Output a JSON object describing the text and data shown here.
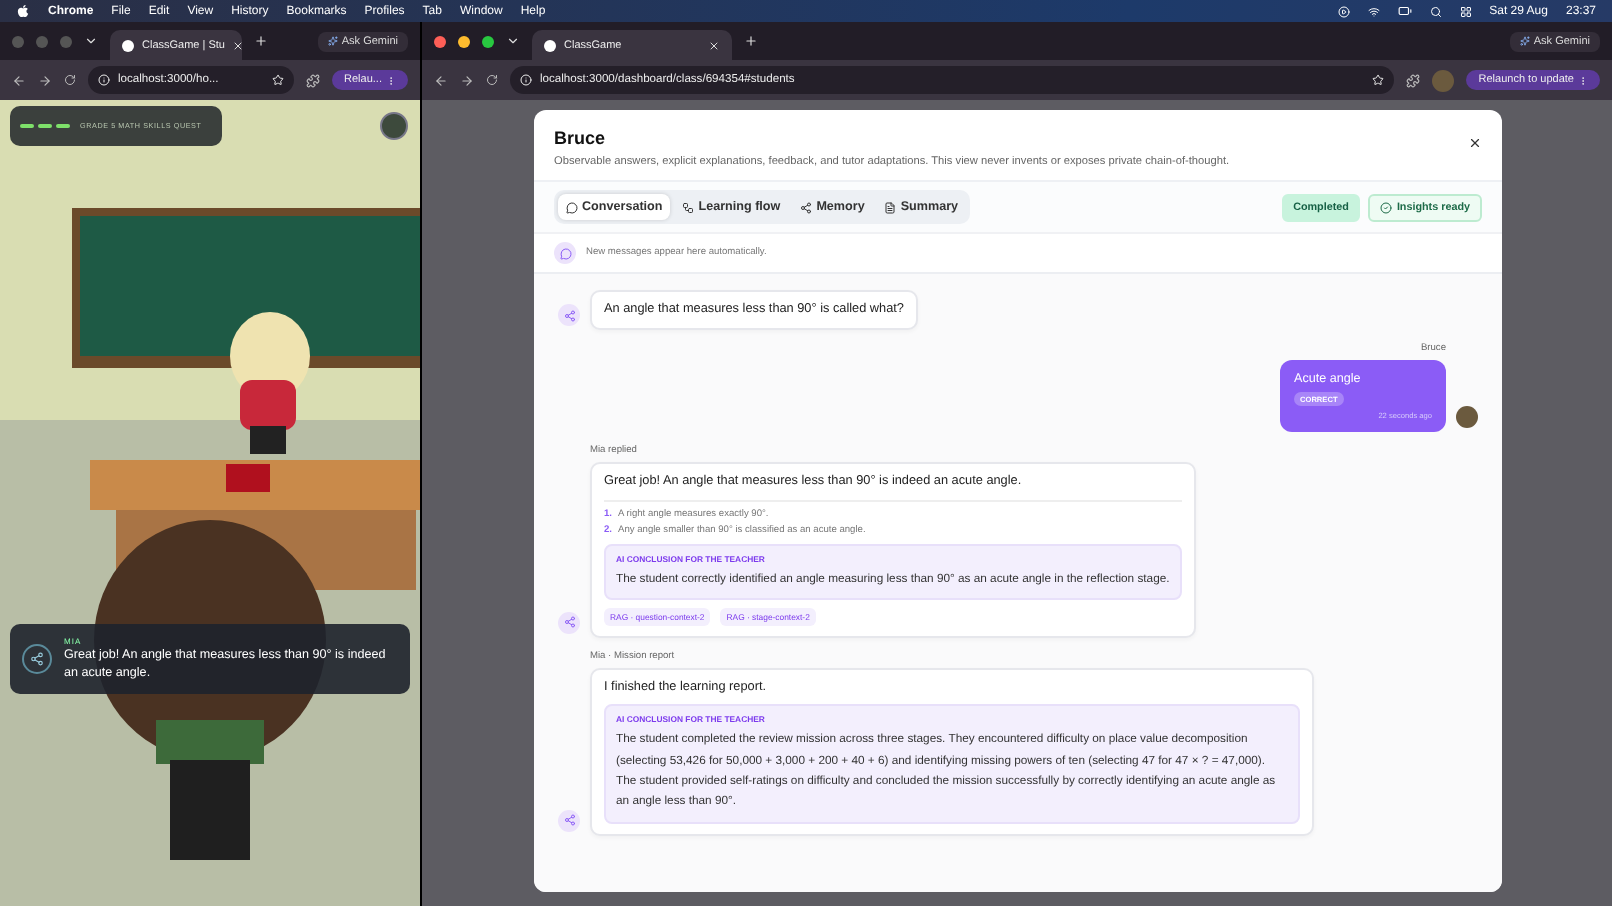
{
  "menu_bar": {
    "app": "Chrome",
    "items": [
      "File",
      "Edit",
      "View",
      "History",
      "Bookmarks",
      "Profiles",
      "Tab",
      "Window",
      "Help"
    ],
    "date": "Sat 29 Aug",
    "time": "23:37"
  },
  "left_window": {
    "tab_title": "ClassGame | Stu",
    "ask_button": "Ask Gemini",
    "url": "localhost:3000/ho...",
    "relaunch": "Relau...",
    "game": {
      "quest_title": "GRADE 5 MATH SKILLS QUEST",
      "dialog": {
        "speaker": "MIA",
        "text": "Great job! An angle that measures less than 90° is indeed an acute angle."
      }
    }
  },
  "right_window": {
    "tab_title": "ClassGame",
    "ask_button": "Ask Gemini",
    "url": "localhost:3000/dashboard/class/694354#students",
    "relaunch": "Relaunch to update"
  },
  "modal": {
    "title": "Bruce",
    "subtitle": "Observable answers, explicit explanations, feedback, and tutor adaptations. This view never invents or exposes private chain-of-thought.",
    "tabs": [
      {
        "label": "Conversation",
        "selected": true
      },
      {
        "label": "Learning flow",
        "selected": false
      },
      {
        "label": "Memory",
        "selected": false
      },
      {
        "label": "Summary",
        "selected": false
      }
    ],
    "badges": [
      {
        "label": "Completed",
        "kind": "status"
      },
      {
        "label": "Insights ready",
        "kind": "insight"
      }
    ],
    "notice": "New messages appear here automatically.",
    "messages": [
      {
        "kind": "tutor",
        "text": "An angle that measures less than 90° is called what?"
      },
      {
        "kind": "student",
        "author": "Bruce",
        "text": "Acute angle",
        "result": "CORRECT",
        "time": "22 seconds ago"
      },
      {
        "kind": "tutor",
        "author": "Mia replied",
        "text": "Great job! An angle that measures less than 90° is indeed an acute angle.",
        "steps": [
          {
            "number": "1.",
            "text": "A right angle measures exactly 90°."
          },
          {
            "number": "2.",
            "text": "Any angle smaller than 90° is classified as an acute angle."
          }
        ],
        "conclusion_label": "AI CONCLUSION FOR THE TEACHER",
        "conclusion": "The student correctly identified an angle measuring less than 90° as an acute angle in the reflection stage.",
        "tags": [
          "RAG · question-context-2",
          "RAG · stage-context-2"
        ]
      },
      {
        "kind": "tutor",
        "author": "Mia · Mission report",
        "text": "I finished the learning report.",
        "conclusion_label": "AI CONCLUSION FOR THE TEACHER",
        "conclusion": "The student completed the review mission across three stages. They encountered difficulty on place value decomposition (selecting 53,426 for 50,000 + 3,000 + 200 + 40 + 6) and identifying missing powers of ten (selecting 47 for 47 × ? = 47,000). The student provided self-ratings on difficulty and concluded the mission successfully by correctly identifying an acute angle as an angle less than 90°."
      }
    ]
  }
}
